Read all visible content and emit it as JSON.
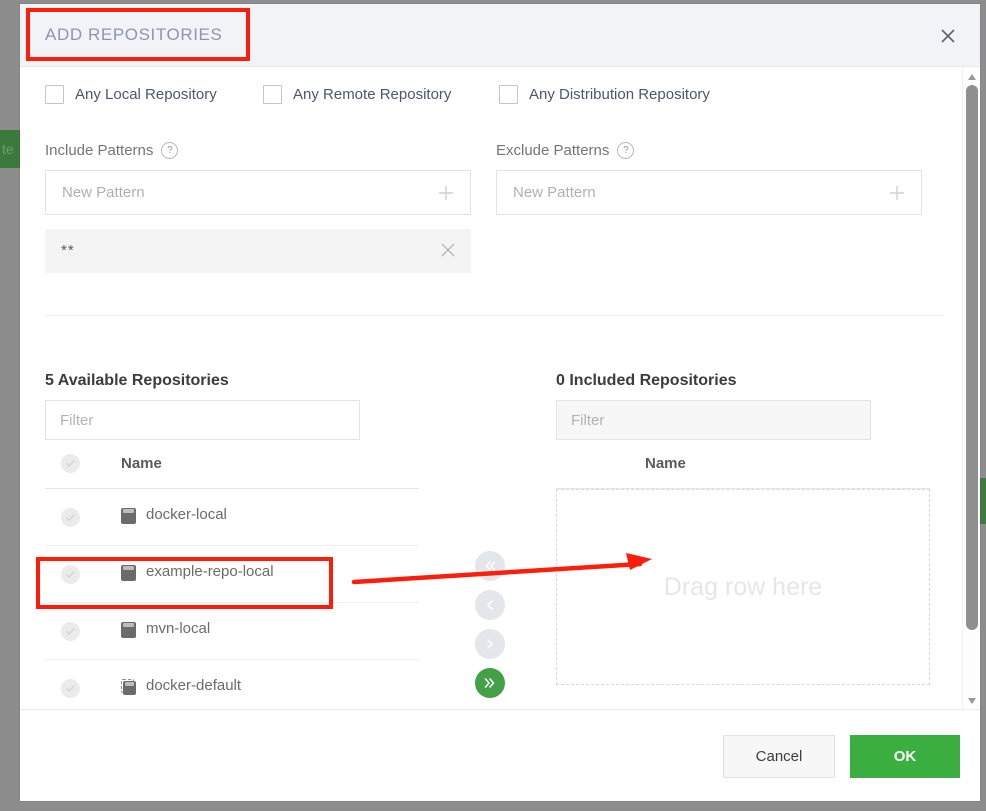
{
  "modal": {
    "title": "ADD REPOSITORIES",
    "close_label": "close-icon"
  },
  "checkboxes": [
    {
      "label": "Any Local Repository",
      "checked": false
    },
    {
      "label": "Any Remote Repository",
      "checked": false
    },
    {
      "label": "Any Distribution Repository",
      "checked": false
    }
  ],
  "include_patterns": {
    "label": "Include Patterns",
    "help": "?",
    "input_placeholder": "New Pattern",
    "input_value": "",
    "chips": [
      {
        "value": "**"
      }
    ]
  },
  "exclude_patterns": {
    "label": "Exclude Patterns",
    "help": "?",
    "input_placeholder": "New Pattern",
    "input_value": "",
    "chips": []
  },
  "available": {
    "title": "5 Available Repositories",
    "filter_placeholder": "Filter",
    "filter_value": "",
    "column_header": "Name",
    "rows": [
      {
        "name": "docker-local",
        "type": "local",
        "selected": false
      },
      {
        "name": "example-repo-local",
        "type": "local",
        "selected": false
      },
      {
        "name": "mvn-local",
        "type": "local",
        "selected": false
      },
      {
        "name": "docker-default",
        "type": "virtual",
        "selected": false
      }
    ]
  },
  "included": {
    "title": "0 Included Repositories",
    "filter_placeholder": "Filter",
    "filter_value": "",
    "column_header": "Name",
    "empty_text": "Drag row here",
    "rows": []
  },
  "transfer_buttons": [
    {
      "name": "move-all-left",
      "glyph": "«",
      "enabled": false
    },
    {
      "name": "move-left",
      "glyph": "‹",
      "enabled": false
    },
    {
      "name": "move-right",
      "glyph": "›",
      "enabled": false
    },
    {
      "name": "move-all-right",
      "glyph": "»",
      "enabled": true
    }
  ],
  "footer": {
    "cancel_label": "Cancel",
    "ok_label": "OK"
  },
  "background": {
    "left_button_fragment": "te"
  },
  "colors": {
    "accent_green": "#3aaf3f",
    "header_bg": "#f2f3f7",
    "title_text": "#8e95b0",
    "annotation_red": "#fc1d0b"
  }
}
